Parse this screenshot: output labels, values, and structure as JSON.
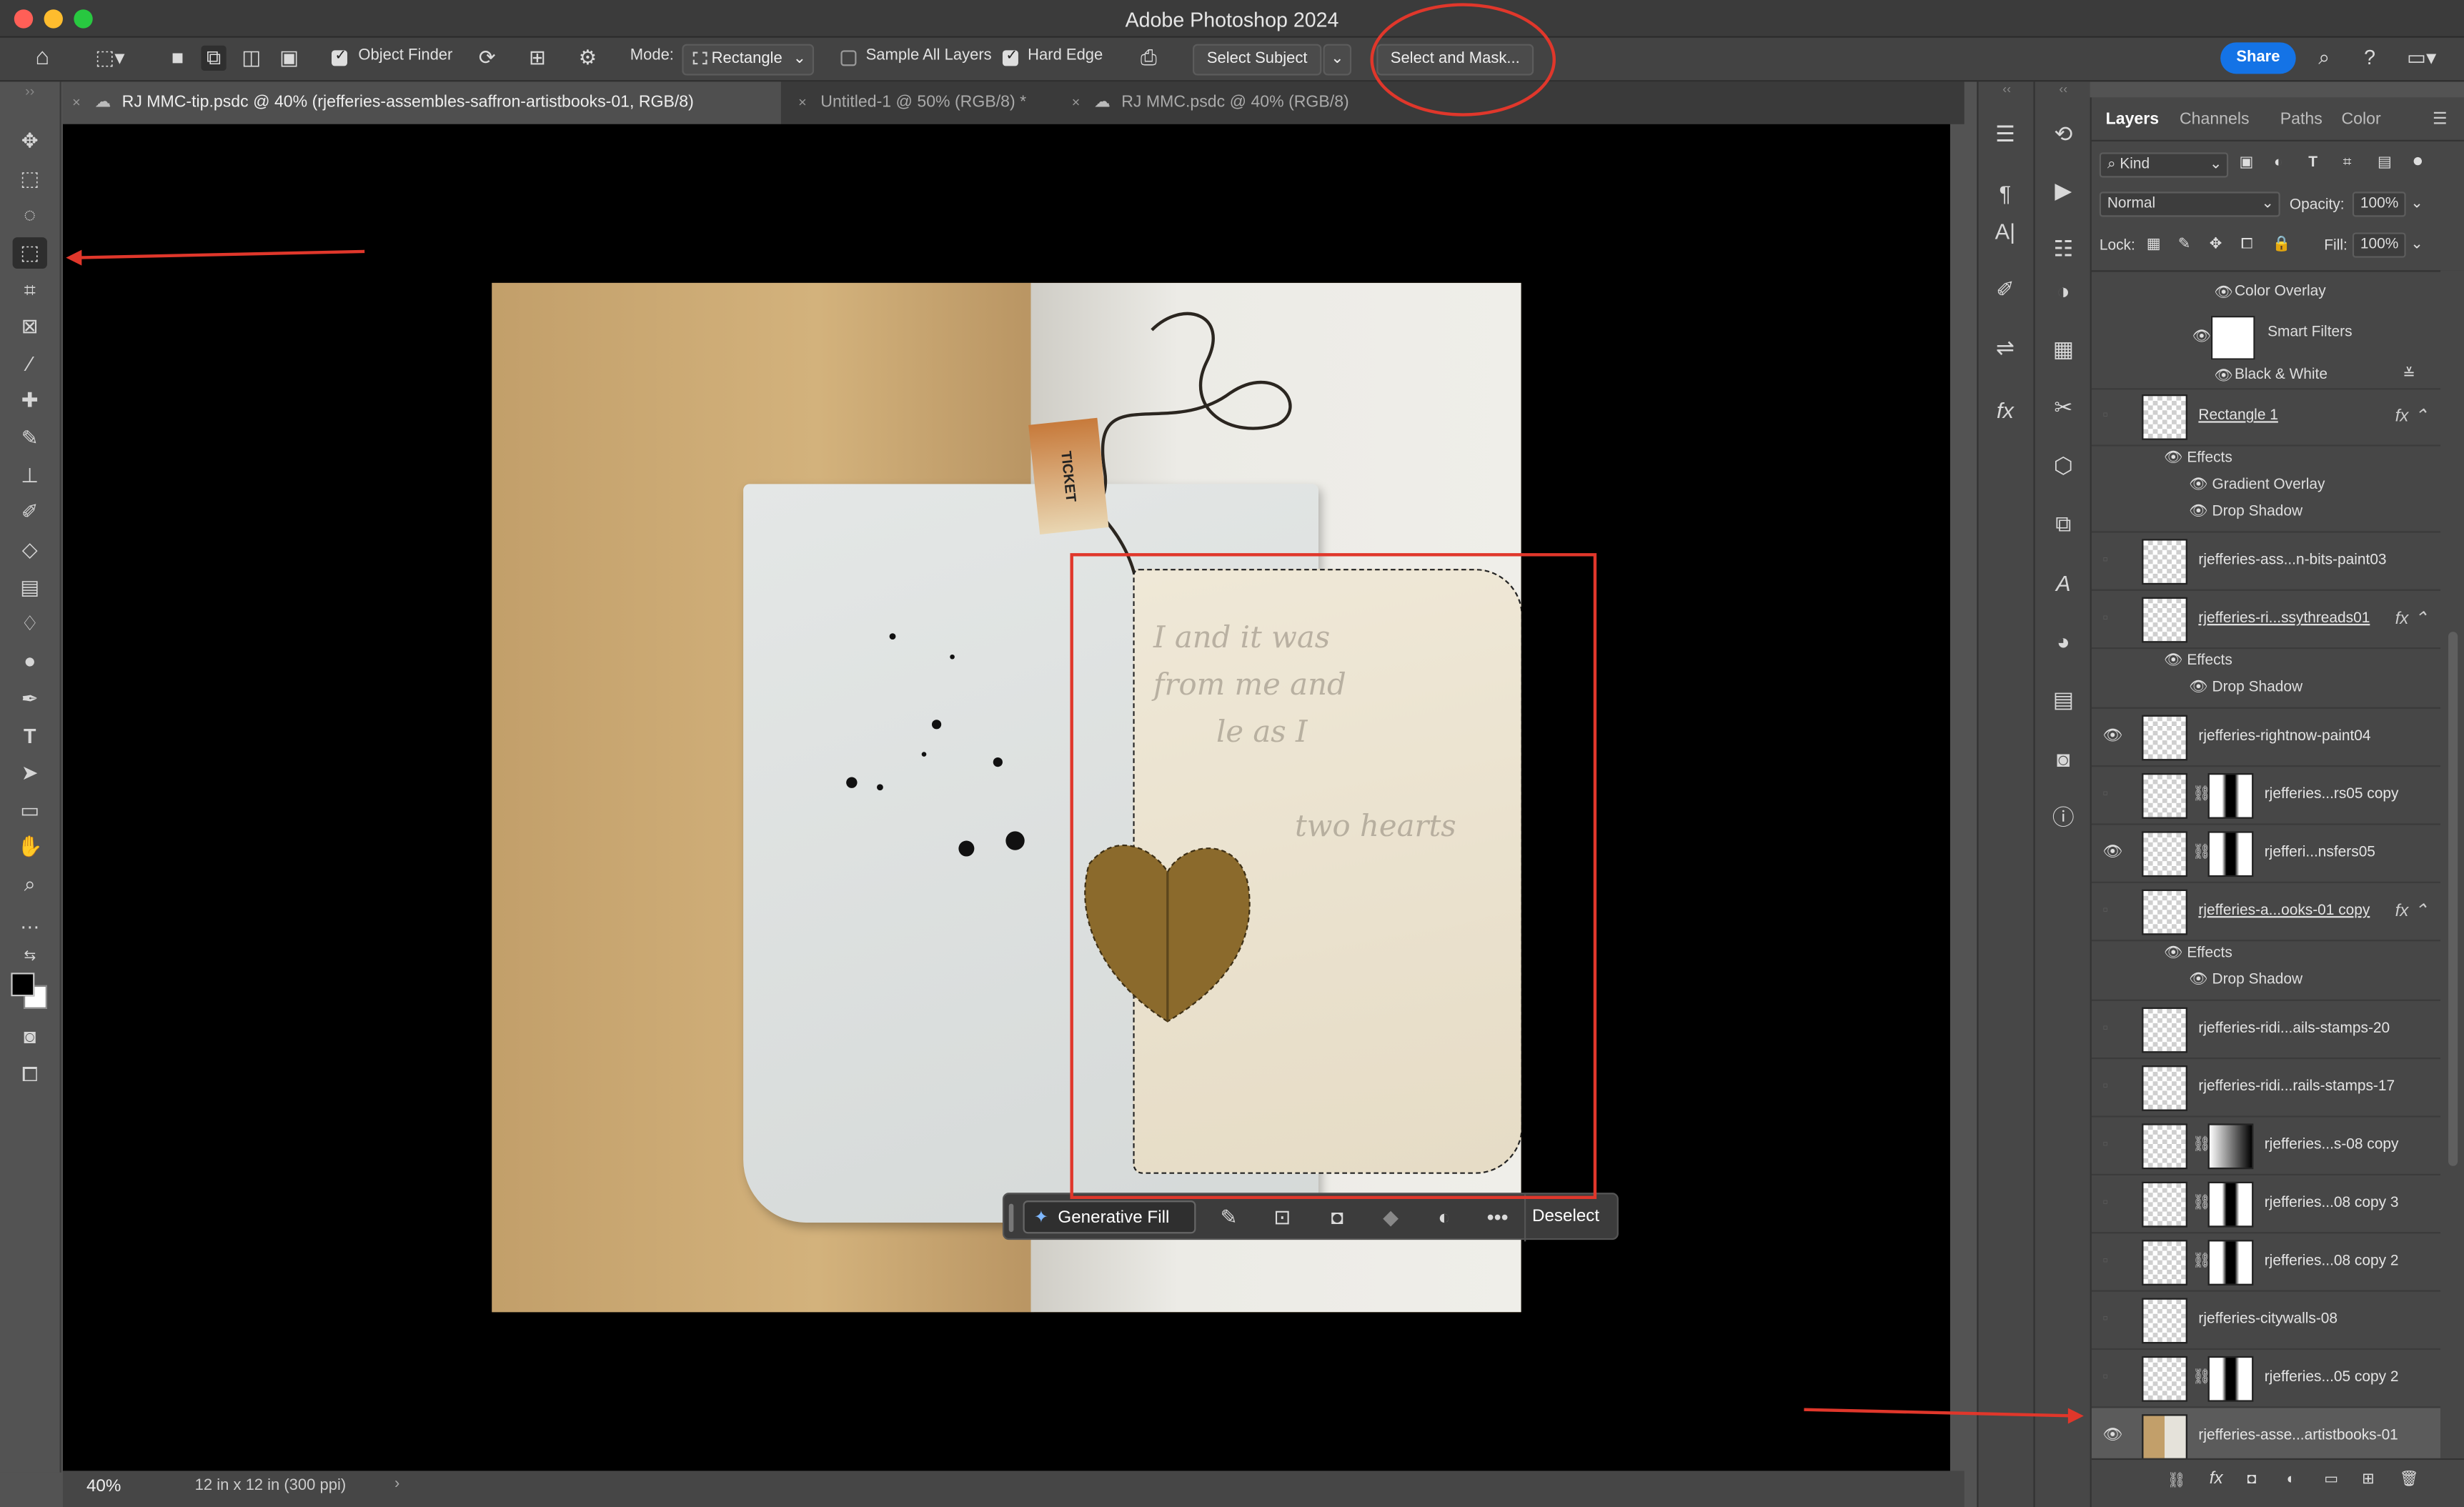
{
  "app": {
    "title": "Adobe Photoshop 2024",
    "traffic_colors": [
      "#ff5f57",
      "#febc2e",
      "#28c840"
    ]
  },
  "options_bar": {
    "object_finder": "Object Finder",
    "mode_label": "Mode:",
    "mode_value": "Rectangle",
    "sample_all_layers": "Sample All Layers",
    "hard_edge": "Hard Edge",
    "select_subject": "Select Subject",
    "select_and_mask": "Select and Mask...",
    "share": "Share",
    "share_color": "#1473e6"
  },
  "tabs": [
    {
      "label": "RJ MMC-tip.psdc @ 40% (rjefferies-assembles-saffron-artistbooks-01, RGB/8)",
      "active": true
    },
    {
      "label": "Untitled-1 @ 50% (RGB/8) *",
      "active": false
    },
    {
      "label": "RJ MMC.psdc @ 40% (RGB/8)",
      "active": false
    }
  ],
  "tools": [
    "move-tool",
    "marquee-tool",
    "lasso-tool",
    "object-selection-tool",
    "pen-tool",
    "frame-tool",
    "eyedropper-tool",
    "healing-tool",
    "brush-tool",
    "stamp-tool",
    "history-brush-tool",
    "eraser-tool",
    "gradient-tool",
    "blur-tool",
    "dodge-tool",
    "pen-path-tool",
    "type-tool",
    "path-selection-tool",
    "rectangle-tool",
    "hand-tool",
    "zoom-tool",
    "more-tools"
  ],
  "status": {
    "zoom": "40%",
    "doc_size": "12 in x 12 in (300 ppi)"
  },
  "context_bar": {
    "generative_fill": "Generative Fill",
    "deselect": "Deselect"
  },
  "layers_panel": {
    "tabs": [
      "Layers",
      "Channels",
      "Paths",
      "Color"
    ],
    "kind": "Kind",
    "blend_mode": "Normal",
    "opacity_label": "Opacity:",
    "opacity": "100%",
    "lock_label": "Lock:",
    "fill_label": "Fill:",
    "fill": "100%",
    "top_effects": [
      "Color Overlay",
      "Smart Filters",
      "Black & White"
    ],
    "layers": [
      {
        "name": "Rectangle 1",
        "fx": true,
        "visible": false,
        "effects_label": "Effects",
        "effects": [
          "Gradient Overlay",
          "Drop Shadow"
        ]
      },
      {
        "name": "rjefferies-ass...n-bits-paint03",
        "fx": false,
        "visible": false
      },
      {
        "name": "rjefferies-ri...ssythreads01",
        "fx": true,
        "visible": false,
        "effects_label": "Effects",
        "effects": [
          "Drop Shadow"
        ]
      },
      {
        "name": "rjefferies-rightnow-paint04",
        "fx": false,
        "visible": true
      },
      {
        "name": "rjefferies...rs05 copy",
        "fx": false,
        "visible": false,
        "mask": true
      },
      {
        "name": "rjefferi...nsfers05",
        "fx": false,
        "visible": true,
        "mask": true
      },
      {
        "name": "rjefferies-a...ooks-01 copy",
        "fx": true,
        "visible": false,
        "effects_label": "Effects",
        "effects": [
          "Drop Shadow"
        ]
      },
      {
        "name": "rjefferies-ridi...ails-stamps-20",
        "fx": false,
        "visible": false
      },
      {
        "name": "rjefferies-ridi...rails-stamps-17",
        "fx": false,
        "visible": false
      },
      {
        "name": "rjefferies...s-08 copy",
        "fx": false,
        "visible": false,
        "mask": true
      },
      {
        "name": "rjefferies...08 copy 3",
        "fx": false,
        "visible": false,
        "mask": true
      },
      {
        "name": "rjefferies...08 copy 2",
        "fx": false,
        "visible": false,
        "mask": true
      },
      {
        "name": "rjefferies-citywalls-08",
        "fx": false,
        "visible": false
      },
      {
        "name": "rjefferies...05 copy 2",
        "fx": false,
        "visible": false,
        "mask": true
      },
      {
        "name": "rjefferies-asse...artistbooks-01",
        "fx": false,
        "visible": true,
        "selected": true
      }
    ]
  },
  "canvas_text": {
    "handwriting": [
      "I and it was",
      "from me and",
      "le as I",
      "two hearts"
    ],
    "ticket": "TICKET"
  },
  "annotation_color": "#e0372b"
}
